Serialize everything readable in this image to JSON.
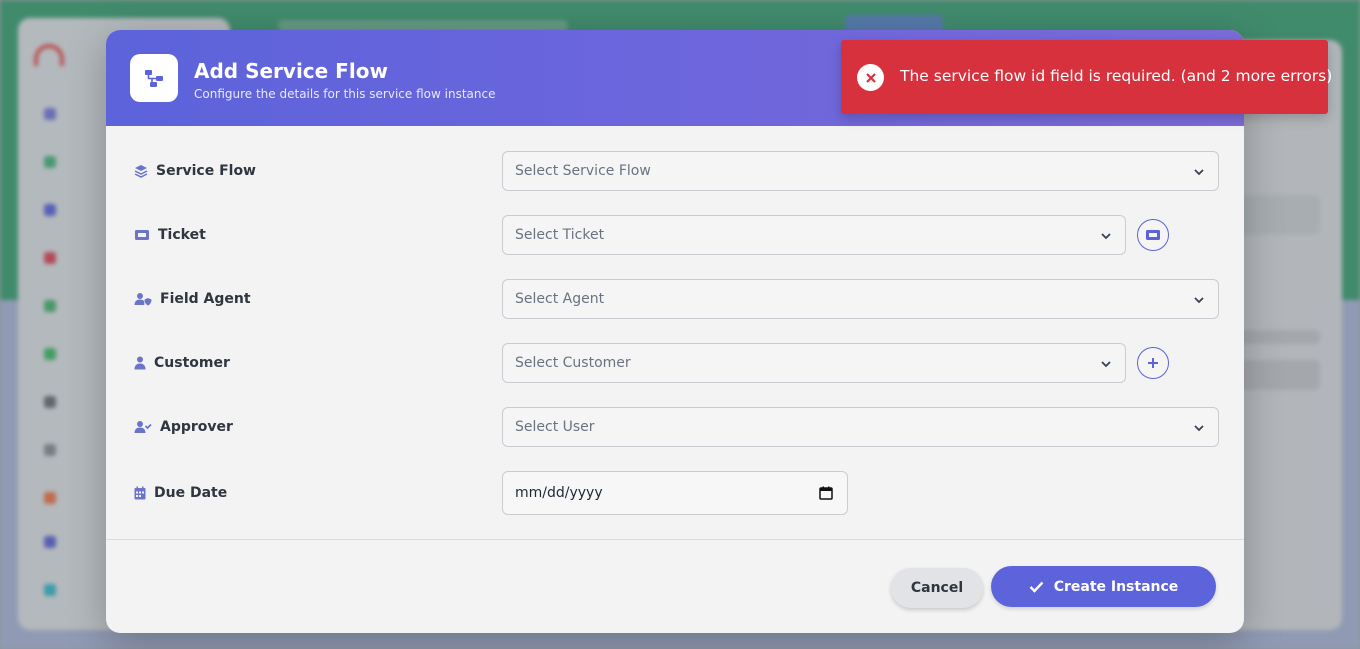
{
  "modal": {
    "title": "Add Service Flow",
    "subtitle": "Configure the details for this service flow instance",
    "header_icon": "flow-diagram-icon",
    "accent_color": "#5c63db"
  },
  "form": {
    "fields": [
      {
        "label": "Service Flow",
        "placeholder": "Select Service Flow",
        "icon": "layers-icon"
      },
      {
        "label": "Ticket",
        "placeholder": "Select Ticket",
        "icon": "ticket-icon",
        "side_button": "ticket-icon"
      },
      {
        "label": "Field Agent",
        "placeholder": "Select Agent",
        "icon": "user-shield-icon"
      },
      {
        "label": "Customer",
        "placeholder": "Select Customer",
        "icon": "user-icon",
        "side_button": "plus-icon"
      },
      {
        "label": "Approver",
        "placeholder": "Select User",
        "icon": "user-check-icon"
      },
      {
        "label": "Due Date",
        "placeholder": "mm/dd/yyyy",
        "icon": "calendar-icon"
      }
    ]
  },
  "footer": {
    "cancel_label": "Cancel",
    "create_label": "Create Instance"
  },
  "toast": {
    "message": "The service flow id field is required. (and 2 more errors)",
    "color": "#d7313d",
    "icon": "close-circle-icon"
  }
}
